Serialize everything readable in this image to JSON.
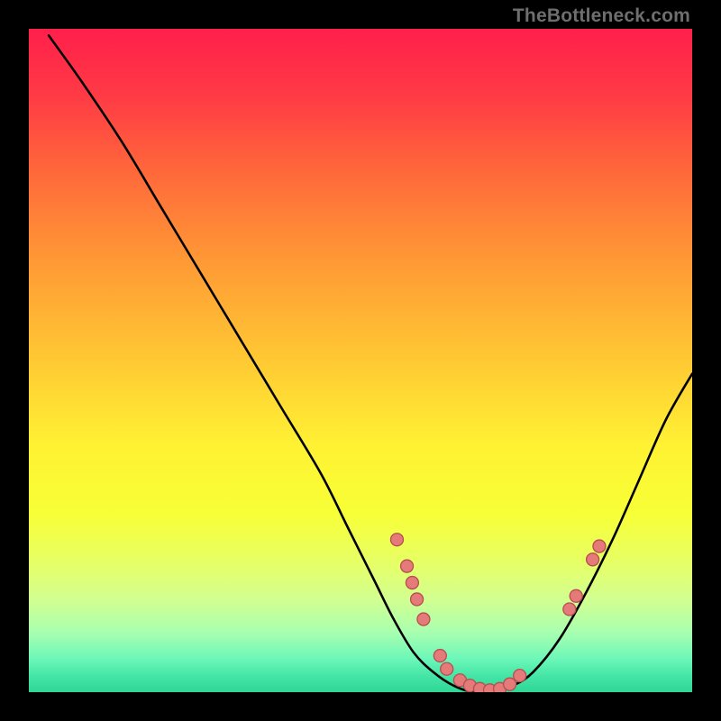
{
  "watermark": "TheBottleneck.com",
  "colors": {
    "bg": "#000000",
    "curve": "#000000",
    "points_fill": "#e47a7a",
    "points_stroke": "#b94e4e",
    "gradient_stops": [
      {
        "offset": 0.0,
        "color": "#ff1f4b"
      },
      {
        "offset": 0.1,
        "color": "#ff3a45"
      },
      {
        "offset": 0.22,
        "color": "#ff6a3a"
      },
      {
        "offset": 0.35,
        "color": "#ff9935"
      },
      {
        "offset": 0.5,
        "color": "#ffc933"
      },
      {
        "offset": 0.63,
        "color": "#fff233"
      },
      {
        "offset": 0.73,
        "color": "#f7ff36"
      },
      {
        "offset": 0.8,
        "color": "#e8ff63"
      },
      {
        "offset": 0.86,
        "color": "#d2ff90"
      },
      {
        "offset": 0.91,
        "color": "#a8ffb0"
      },
      {
        "offset": 0.95,
        "color": "#6cf7b8"
      },
      {
        "offset": 0.975,
        "color": "#45e6a7"
      },
      {
        "offset": 1.0,
        "color": "#2fd695"
      }
    ]
  },
  "chart_data": {
    "type": "line",
    "title": "",
    "xlabel": "",
    "ylabel": "",
    "xlim": [
      0,
      100
    ],
    "ylim": [
      0,
      100
    ],
    "grid": false,
    "legend": false,
    "series": [
      {
        "name": "bottleneck-curve",
        "x": [
          3,
          8,
          14,
          20,
          26,
          32,
          38,
          44,
          48,
          52,
          55,
          58,
          61,
          64,
          67,
          70,
          73,
          76,
          80,
          84,
          88,
          92,
          96,
          100
        ],
        "y": [
          99,
          92,
          83,
          73,
          63,
          53,
          43,
          33,
          25,
          17,
          11,
          6,
          3,
          1,
          0,
          0,
          1,
          3,
          8,
          15,
          23,
          32,
          41,
          48
        ]
      }
    ],
    "points": [
      {
        "x": 55.5,
        "y": 23.0
      },
      {
        "x": 57.0,
        "y": 19.0
      },
      {
        "x": 57.8,
        "y": 16.5
      },
      {
        "x": 58.5,
        "y": 14.0
      },
      {
        "x": 59.5,
        "y": 11.0
      },
      {
        "x": 62.0,
        "y": 5.5
      },
      {
        "x": 63.0,
        "y": 3.5
      },
      {
        "x": 65.0,
        "y": 1.8
      },
      {
        "x": 66.5,
        "y": 1.0
      },
      {
        "x": 68.0,
        "y": 0.5
      },
      {
        "x": 69.5,
        "y": 0.3
      },
      {
        "x": 71.0,
        "y": 0.5
      },
      {
        "x": 72.5,
        "y": 1.2
      },
      {
        "x": 74.0,
        "y": 2.5
      },
      {
        "x": 81.5,
        "y": 12.5
      },
      {
        "x": 82.5,
        "y": 14.5
      },
      {
        "x": 85.0,
        "y": 20.0
      },
      {
        "x": 86.0,
        "y": 22.0
      }
    ]
  }
}
